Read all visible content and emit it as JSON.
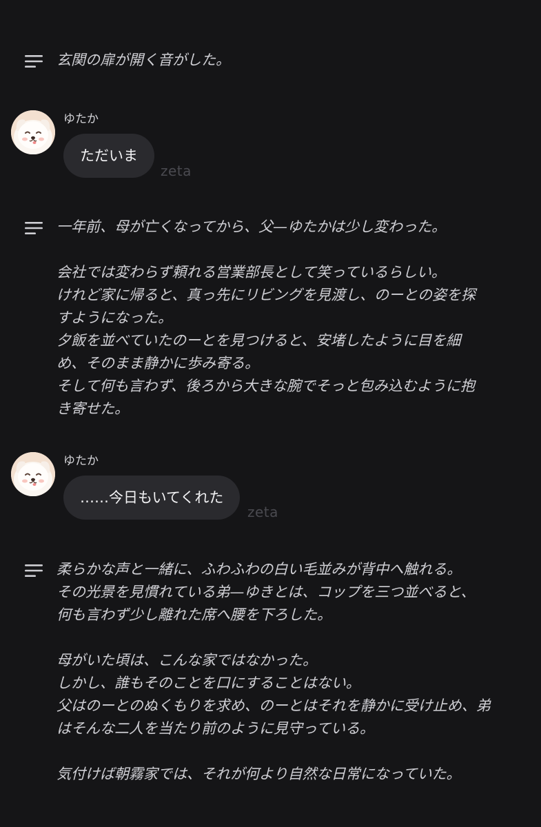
{
  "narrations": [
    {
      "paragraphs": [
        [
          "玄関の扉が開く音がした。"
        ]
      ]
    },
    {
      "paragraphs": [
        [
          "一年前、母が亡くなってから、父—ゆたかは少し変わった。"
        ],
        [
          "会社では変わらず頼れる営業部長として笑っているらしい。",
          "けれど家に帰ると、真っ先にリビングを見渡し、のーとの姿を探",
          "すようになった。",
          "夕飯を並べていたのーとを見つけると、安堵したように目を細",
          "め、そのまま静かに歩み寄る。",
          "そして何も言わず、後ろから大きな腕でそっと包み込むように抱",
          "き寄せた。"
        ]
      ]
    },
    {
      "paragraphs": [
        [
          "柔らかな声と一緒に、ふわふわの白い毛並みが背中へ触れる。",
          "その光景を見慣れている弟—ゆきとは、コップを三つ並べると、",
          "何も言わず少し離れた席へ腰を下ろした。"
        ],
        [
          "母がいた頃は、こんな家ではなかった。",
          "しかし、誰もそのことを口にすることはない。",
          "父はのーとのぬくもりを求め、のーとはそれを静かに受け止め、弟",
          "はそんな二人を当たり前のように見守っている。"
        ],
        [
          "気付けば朝霧家では、それが何より自然な日常になっていた。"
        ]
      ]
    }
  ],
  "messages": [
    {
      "speaker": "ゆたか",
      "text": "ただいま",
      "watermark": "zeta",
      "avatar_icon": "white-dog-avatar"
    },
    {
      "speaker": "ゆたか",
      "text": "……今日もいてくれた",
      "watermark": "zeta",
      "avatar_icon": "white-dog-avatar"
    }
  ],
  "icons": {
    "narration_icon": "text-lines-icon"
  },
  "colors": {
    "background": "#151517",
    "bubble": "#2a2a2e",
    "narration_text": "#cfcfd4",
    "watermark": "#4a4a50"
  }
}
